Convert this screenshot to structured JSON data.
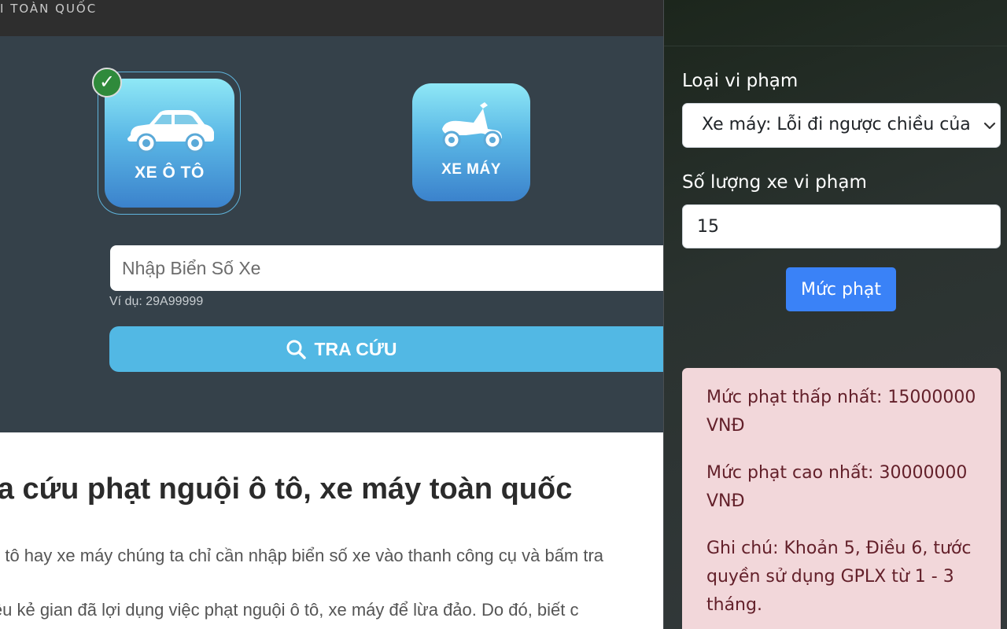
{
  "topbar": {
    "title": "I TOÀN QUỐC"
  },
  "vehicles": {
    "car": {
      "label": "XE Ô TÔ",
      "selected": true,
      "check_mark": "✓"
    },
    "moto": {
      "label": "XE MÁY",
      "selected": false
    }
  },
  "search": {
    "placeholder": "Nhập Biển Số Xe",
    "value": "",
    "hint": "Ví dụ: 29A99999",
    "button_label": "TRA CỨU"
  },
  "article": {
    "title": "ra cứu phạt nguội ô tô, xe máy toàn quốc",
    "paragraphs": [
      "ô tô hay xe máy chúng ta chỉ cần nhập biển số xe vào thanh công cụ và bấm tra",
      "iều kẻ gian đã lợi dụng việc phạt nguội ô tô, xe máy để lừa đảo. Do đó, biết c"
    ]
  },
  "panel": {
    "violation_type_label": "Loại vi phạm",
    "violation_type_value": "Xe máy: Lỗi đi ngược chiều của",
    "vehicle_count_label": "Số lượng xe vi phạm",
    "vehicle_count_value": "15",
    "fine_button_label": "Mức phạt",
    "result": {
      "min_fine": "Mức phạt thấp nhất: 15000000 VNĐ",
      "max_fine": "Mức phạt cao nhất: 30000000 VNĐ",
      "note": "Ghi chú: Khoản 5, Điều 6, tước quyền sử dụng GPLX từ 1 - 3 tháng."
    }
  },
  "colors": {
    "hero_bg": "#35414a",
    "accent_button": "#52b8e4",
    "fine_button": "#3a82f7",
    "result_bg": "#f2d7da",
    "result_text": "#63202a",
    "check_badge": "#2f8a3b"
  },
  "icons": {
    "car": "car-icon",
    "moto": "scooter-icon",
    "search": "search-icon",
    "check": "check-icon",
    "select_arrow": "chevron-down-icon"
  }
}
